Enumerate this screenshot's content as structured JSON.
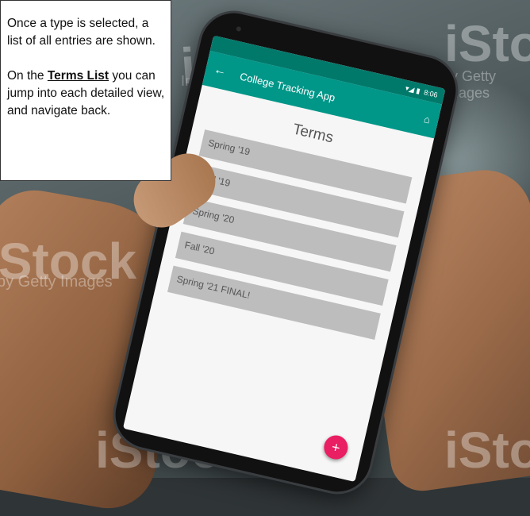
{
  "callout": {
    "line1": "Once a type is selected, a list of all entries are shown.",
    "line2_prefix": "On the ",
    "line2_bold": "Terms List",
    "line2_suffix": " you can jump into each detailed view, and navigate back."
  },
  "watermarks": [
    "iStock",
    "by Getty Images",
    "iStock",
    "by Getty Images",
    "iStock",
    "iStock",
    "Images"
  ],
  "status_bar": {
    "time": "8:06",
    "icons": "▾◢ ▮"
  },
  "app_bar": {
    "title": "College Tracking App",
    "back_icon": "arrow-back-icon",
    "home_icon": "home-icon"
  },
  "screen": {
    "heading": "Terms",
    "terms": [
      "Spring '19",
      "Fall '19",
      "Spring '20",
      "Fall '20",
      "Spring '21 FINAL!"
    ]
  },
  "fab": {
    "label": "+",
    "icon": "add-icon"
  },
  "colors": {
    "primary": "#009688",
    "primary_dark": "#00796b",
    "accent": "#e91e63",
    "list_item": "#bdbdbd"
  }
}
